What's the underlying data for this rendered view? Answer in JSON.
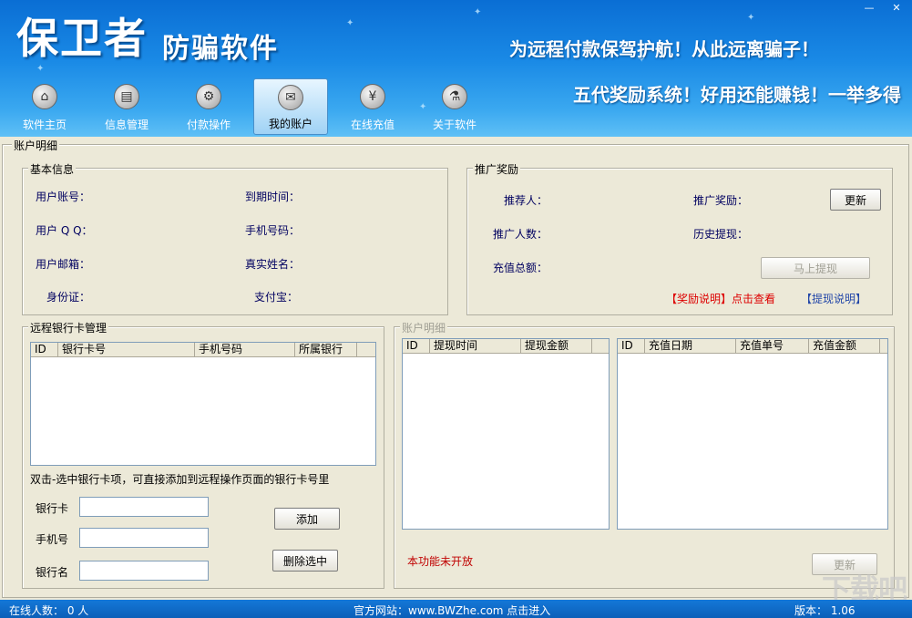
{
  "header": {
    "logo_main": "保卫者",
    "logo_sub": "防骗软件",
    "slogan1": "为远程付款保驾护航！从此远离骗子！",
    "slogan2": "五代奖励系统！好用还能赚钱！一举多得",
    "min_btn": "—",
    "close_btn": "✕"
  },
  "nav": [
    {
      "label": "软件主页",
      "icon": "home-icon",
      "glyph": "⌂"
    },
    {
      "label": "信息管理",
      "icon": "document-icon",
      "glyph": "▤"
    },
    {
      "label": "付款操作",
      "icon": "gear-icon",
      "glyph": "⚙"
    },
    {
      "label": "我的账户",
      "icon": "mail-icon",
      "glyph": "✉"
    },
    {
      "label": "在线充值",
      "icon": "yen-icon",
      "glyph": "¥"
    },
    {
      "label": "关于软件",
      "icon": "microscope-icon",
      "glyph": "⚗"
    }
  ],
  "main": {
    "outer_title": "账户明细",
    "basic": {
      "title": "基本信息",
      "account": "用户账号：",
      "expire": "到期时间：",
      "qq": "用户 Q Q：",
      "phone": "手机号码：",
      "email": "用户邮箱：",
      "realname": "真实姓名：",
      "idcard": "身份证：",
      "alipay": "支付宝："
    },
    "promo": {
      "title": "推广奖励",
      "referrer": "推荐人：",
      "reward": "推广奖励：",
      "refresh": "更新",
      "count": "推广人数：",
      "history": "历史提现：",
      "recharge_total": "充值总额：",
      "withdraw": "马上提现",
      "reward_note": "【奖励说明】点击查看",
      "withdraw_note": "【提现说明】"
    },
    "bank": {
      "title": "远程银行卡管理",
      "columns": [
        "ID",
        "银行卡号",
        "手机号码",
        "所属银行"
      ],
      "hint": "双击-选中银行卡项，可直接添加到远程操作页面的银行卡号里",
      "card_label": "银行卡",
      "phone_label": "手机号",
      "bankname_label": "银行名",
      "add": "添加",
      "delete": "删除选中"
    },
    "detail": {
      "title": "账户明细",
      "withdraw_columns": [
        "ID",
        "提现时间",
        "提现金额"
      ],
      "recharge_columns": [
        "ID",
        "充值日期",
        "充值单号",
        "充值金额"
      ],
      "not_open": "本功能未开放",
      "refresh": "更新"
    }
  },
  "status": {
    "online": "在线人数： 0 人",
    "website": "官方网站：www.BWZhe.com  点击进入",
    "version": "版本： 1.06",
    "watermark": "下载吧"
  }
}
